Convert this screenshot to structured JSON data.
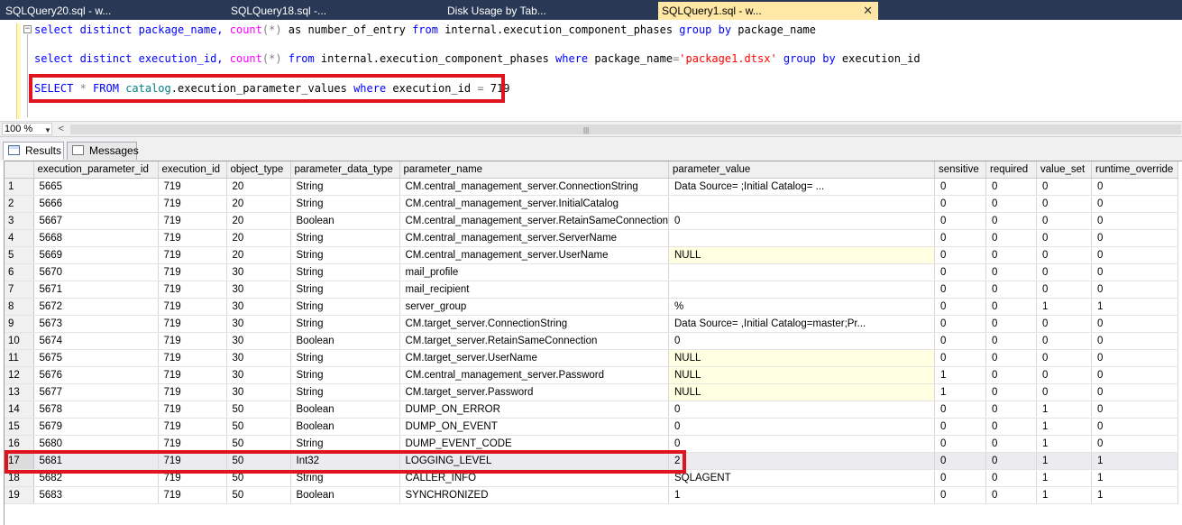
{
  "tabs": [
    {
      "label": "SQLQuery20.sql - w..."
    },
    {
      "label": "SQLQuery18.sql -..."
    },
    {
      "label": "Disk Usage by Tab..."
    },
    {
      "label": "SQLQuery1.sql - w...",
      "close": "✕"
    }
  ],
  "editor": {
    "line1": {
      "a": "select distinct package_name, ",
      "b": "count",
      "c": "(*)",
      "d": " as number_of_entry ",
      "e": "from",
      "f": " internal.execution_component_phases ",
      "g": "group by",
      "h": " package_name"
    },
    "line2": {
      "a": "select distinct execution_id, ",
      "b": "count",
      "c": "(*)",
      "d": " ",
      "e": "from",
      "f": " internal.execution_component_phases ",
      "g": "where",
      "h": " package_name",
      "i": "=",
      "j": "'package1.dtsx'",
      "k": " ",
      "l": "group by",
      "m": " execution_id"
    },
    "line3": {
      "a": "SELECT",
      "b": " * ",
      "c": "FROM",
      "d": " ",
      "e": "catalog",
      "f": ".execution_parameter_values ",
      "g": "where",
      "h": " execution_id ",
      "i": "=",
      "j": " 719"
    },
    "collapse_glyph": "−"
  },
  "zoom": {
    "value": "100 %",
    "dropdown_glyph": "▼",
    "scroll_left_glyph": "<",
    "grip_glyph": "|||"
  },
  "result_tabs": {
    "results": "Results",
    "messages": "Messages"
  },
  "grid": {
    "columns": [
      "execution_parameter_id",
      "execution_id",
      "object_type",
      "parameter_data_type",
      "parameter_name",
      "parameter_value",
      "sensitive",
      "required",
      "value_set",
      "runtime_override"
    ],
    "rows": [
      {
        "n": "1",
        "c": [
          "5665",
          "719",
          "20",
          "String",
          "CM.central_management_server.ConnectionString",
          "Data Source=                                ;Initial Catalog=          ...",
          "0",
          "0",
          "0",
          "0"
        ]
      },
      {
        "n": "2",
        "c": [
          "5666",
          "719",
          "20",
          "String",
          "CM.central_management_server.InitialCatalog",
          "",
          "0",
          "0",
          "0",
          "0"
        ]
      },
      {
        "n": "3",
        "c": [
          "5667",
          "719",
          "20",
          "Boolean",
          "CM.central_management_server.RetainSameConnection",
          "0",
          "0",
          "0",
          "0",
          "0"
        ]
      },
      {
        "n": "4",
        "c": [
          "5668",
          "719",
          "20",
          "String",
          "CM.central_management_server.ServerName",
          "",
          "0",
          "0",
          "0",
          "0"
        ]
      },
      {
        "n": "5",
        "c": [
          "5669",
          "719",
          "20",
          "String",
          "CM.central_management_server.UserName",
          "NULL",
          "0",
          "0",
          "0",
          "0"
        ],
        "null": true
      },
      {
        "n": "6",
        "c": [
          "5670",
          "719",
          "30",
          "String",
          "mail_profile",
          "",
          "0",
          "0",
          "0",
          "0"
        ]
      },
      {
        "n": "7",
        "c": [
          "5671",
          "719",
          "30",
          "String",
          "mail_recipient",
          "",
          "0",
          "0",
          "0",
          "0"
        ]
      },
      {
        "n": "8",
        "c": [
          "5672",
          "719",
          "30",
          "String",
          "server_group",
          "%",
          "0",
          "0",
          "1",
          "1"
        ]
      },
      {
        "n": "9",
        "c": [
          "5673",
          "719",
          "30",
          "String",
          "CM.target_server.ConnectionString",
          "Data Source=                          ,Initial Catalog=master;Pr...",
          "0",
          "0",
          "0",
          "0"
        ]
      },
      {
        "n": "10",
        "c": [
          "5674",
          "719",
          "30",
          "Boolean",
          "CM.target_server.RetainSameConnection",
          "0",
          "0",
          "0",
          "0",
          "0"
        ]
      },
      {
        "n": "11",
        "c": [
          "5675",
          "719",
          "30",
          "String",
          "CM.target_server.UserName",
          "NULL",
          "0",
          "0",
          "0",
          "0"
        ],
        "null": true
      },
      {
        "n": "12",
        "c": [
          "5676",
          "719",
          "30",
          "String",
          "CM.central_management_server.Password",
          "NULL",
          "1",
          "0",
          "0",
          "0"
        ],
        "null": true
      },
      {
        "n": "13",
        "c": [
          "5677",
          "719",
          "30",
          "String",
          "CM.target_server.Password",
          "NULL",
          "1",
          "0",
          "0",
          "0"
        ],
        "null": true
      },
      {
        "n": "14",
        "c": [
          "5678",
          "719",
          "50",
          "Boolean",
          "DUMP_ON_ERROR",
          "0",
          "0",
          "0",
          "1",
          "0"
        ]
      },
      {
        "n": "15",
        "c": [
          "5679",
          "719",
          "50",
          "Boolean",
          "DUMP_ON_EVENT",
          "0",
          "0",
          "0",
          "1",
          "0"
        ]
      },
      {
        "n": "16",
        "c": [
          "5680",
          "719",
          "50",
          "String",
          "DUMP_EVENT_CODE",
          "0",
          "0",
          "0",
          "1",
          "0"
        ]
      },
      {
        "n": "17",
        "c": [
          "5681",
          "719",
          "50",
          "Int32",
          "LOGGING_LEVEL",
          "2",
          "0",
          "0",
          "1",
          "1"
        ],
        "selected": true
      },
      {
        "n": "18",
        "c": [
          "5682",
          "719",
          "50",
          "String",
          "CALLER_INFO",
          "SQLAGENT",
          "0",
          "0",
          "1",
          "1"
        ]
      },
      {
        "n": "19",
        "c": [
          "5683",
          "719",
          "50",
          "Boolean",
          "SYNCHRONIZED",
          "1",
          "0",
          "0",
          "1",
          "1"
        ]
      }
    ]
  },
  "colors": {
    "highlight_box": "#e0141e",
    "tab_bar": "#293955",
    "active_tab": "#ffe8a6",
    "null_cell": "#ffffe1"
  }
}
